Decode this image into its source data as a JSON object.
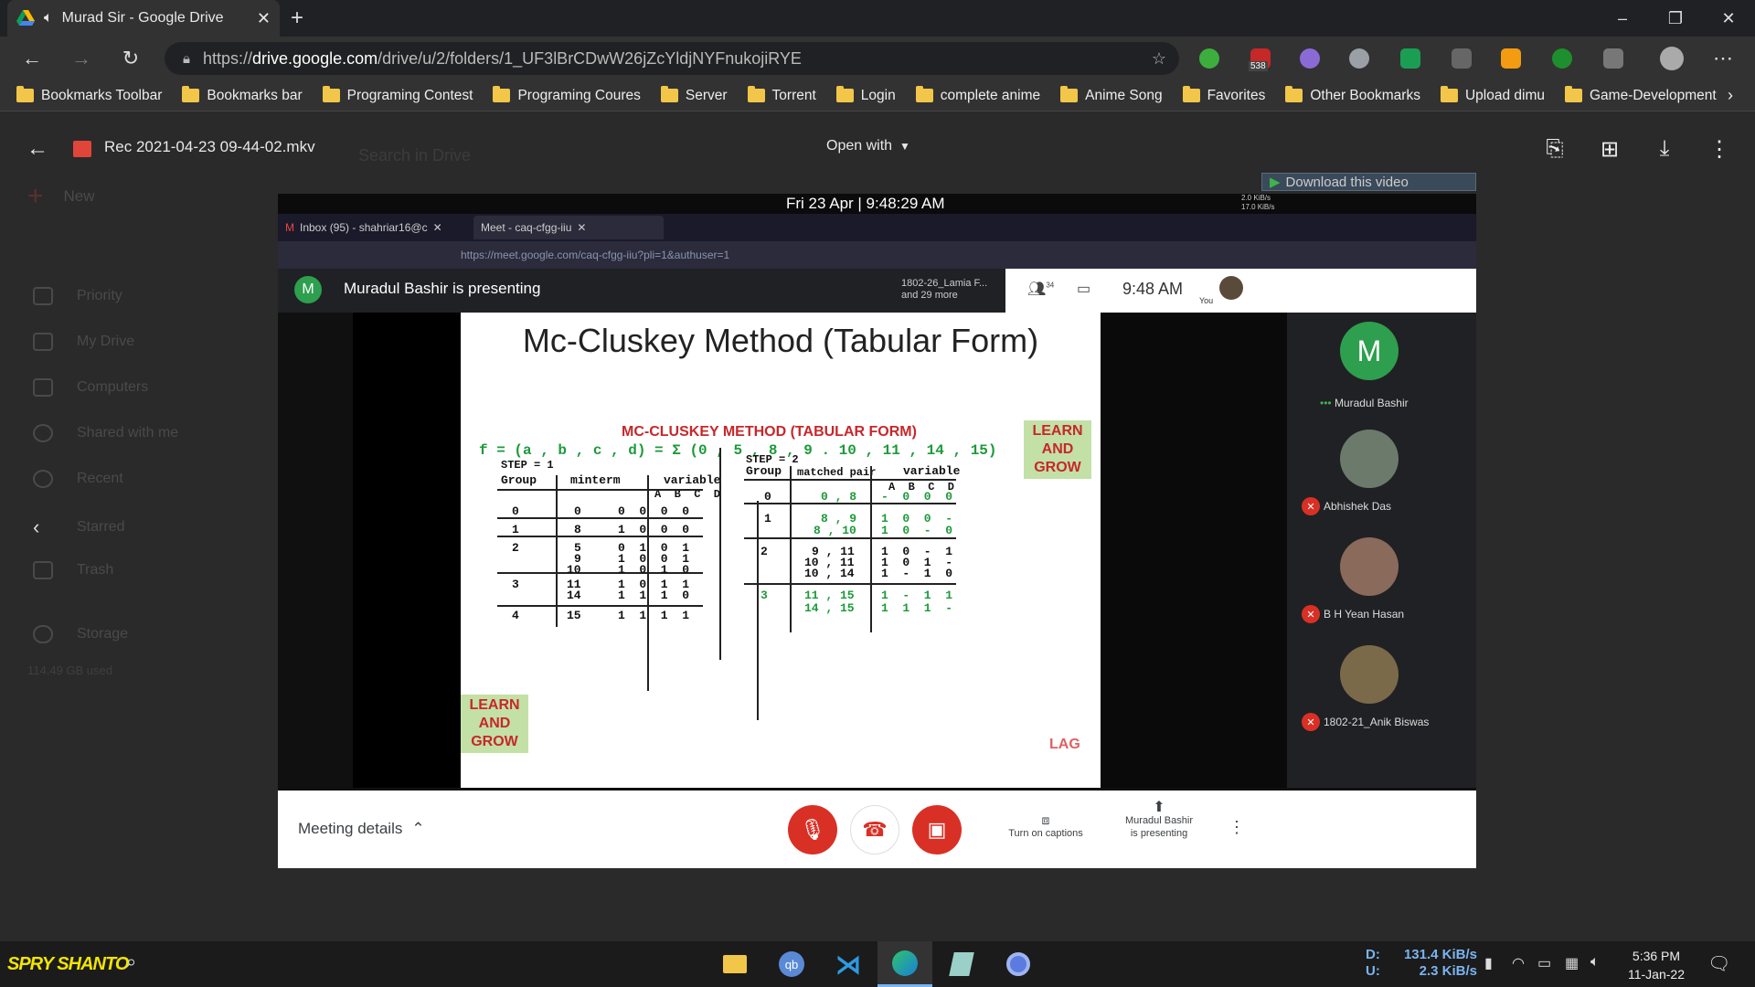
{
  "browser": {
    "tab_title": "Murad Sir - Google Drive",
    "url_prefix": "https://",
    "url_host": "drive.google.com",
    "url_path": "/drive/u/2/folders/1_UF3lBrCDwW26jZcYldjNYFnukojiRYE",
    "ext_badge": "538",
    "bookmarks": [
      "Bookmarks Toolbar",
      "Bookmarks bar",
      "Programing Contest",
      "Programing Coures",
      "Server",
      "Torrent",
      "Login",
      "complete anime",
      "Anime Song",
      "Favorites",
      "Other Bookmarks",
      "Upload dimu",
      "Game-Development"
    ]
  },
  "drive": {
    "search_placeholder": "Search in Drive",
    "new_label": "New",
    "sidebar": [
      "Priority",
      "My Drive",
      "Computers",
      "Shared with me",
      "Recent",
      "Starred",
      "Trash",
      "Storage"
    ],
    "storage_used": "114.49 GB used"
  },
  "viewer": {
    "filename": "Rec 2021-04-23 09-44-02.mkv",
    "open_with": "Open with",
    "download_overlay": "Download this video"
  },
  "recording": {
    "datetime": "Fri 23 Apr | 9:48:29 AM",
    "net_up": "2.0 KiB/s",
    "net_down": "17.0 KiB/s",
    "tab1": "Inbox (95) - shahriar16@c",
    "tab2": "Meet - caq-cfgg-iiu",
    "url": "https://meet.google.com/caq-cfgg-iiu?pli=1&authuser=1",
    "presenter_initial": "M",
    "presenter_text": "Muradul Bashir is presenting",
    "others_name": "1802-26_Lamia F...",
    "others_more": "and 29 more",
    "participant_count": "34",
    "clock": "9:48 AM",
    "you_label": "You",
    "participants": [
      {
        "name": "Muradul Bashir",
        "initial": "M"
      },
      {
        "name": "Abhishek Das"
      },
      {
        "name": "B H Yean Hasan"
      },
      {
        "name": "1802-21_Anik Biswas"
      }
    ],
    "meeting_details": "Meeting details",
    "captions": "Turn on captions",
    "presenting_line1": "Muradul Bashir",
    "presenting_line2": "is presenting"
  },
  "slide": {
    "title": "Mc-Cluskey Method (Tabular Form)",
    "subtitle": "MC-CLUSKEY METHOD (TABULAR FORM)",
    "function": "f = (a , b , c , d) = Σ (0 , 5 , 8 , 9 . 10 , 11 , 14 , 15)",
    "badge": "LEARN AND GROW",
    "lag": "LAG",
    "step1": "STEP = 1",
    "step2": "STEP = 2",
    "group": "Group",
    "minterm": "minterm",
    "variable": "variable",
    "matched_pair": "matched pair",
    "abcd": "A  B  C  D",
    "table1": [
      {
        "g": "0",
        "m": "0",
        "v": "0  0  0  0"
      },
      {
        "g": "1",
        "m": "8",
        "v": "1  0  0  0"
      },
      {
        "g": "2",
        "m": "5",
        "v": "0  1  0  1"
      },
      {
        "g": "",
        "m": "9",
        "v": "1  0  0  1"
      },
      {
        "g": "",
        "m": "10",
        "v": "1  0  1  0"
      },
      {
        "g": "3",
        "m": "11",
        "v": "1  0  1  1"
      },
      {
        "g": "",
        "m": "14",
        "v": "1  1  1  0"
      },
      {
        "g": "4",
        "m": "15",
        "v": "1  1  1  1"
      }
    ],
    "table2": [
      {
        "g": "0",
        "m": "0 , 8",
        "v": "-  0  0  0"
      },
      {
        "g": "1",
        "m": "8 , 9",
        "v": "1  0  0  -"
      },
      {
        "g": "",
        "m": "8 , 10",
        "v": "1  0  -  0"
      },
      {
        "g": "2",
        "m": "9 , 11",
        "v": "1  0  -  1"
      },
      {
        "g": "",
        "m": "10 , 11",
        "v": "1  0  1  -"
      },
      {
        "g": "",
        "m": "10 , 14",
        "v": "1  -  1  0"
      },
      {
        "g": "3",
        "m": "11 , 15",
        "v": "1  -  1  1"
      },
      {
        "g": "",
        "m": "14 , 15",
        "v": "1  1  1  -"
      }
    ]
  },
  "taskbar": {
    "brand": "SPRY SHANTO",
    "net_d_label": "D:",
    "net_d": "131.4 KiB/s",
    "net_u_label": "U:",
    "net_u": "2.3 KiB/s",
    "time": "5:36 PM",
    "date": "11-Jan-22"
  },
  "colors": {
    "accent": "#1d9a3a",
    "danger": "#d93025",
    "folder": "#f2c649"
  }
}
